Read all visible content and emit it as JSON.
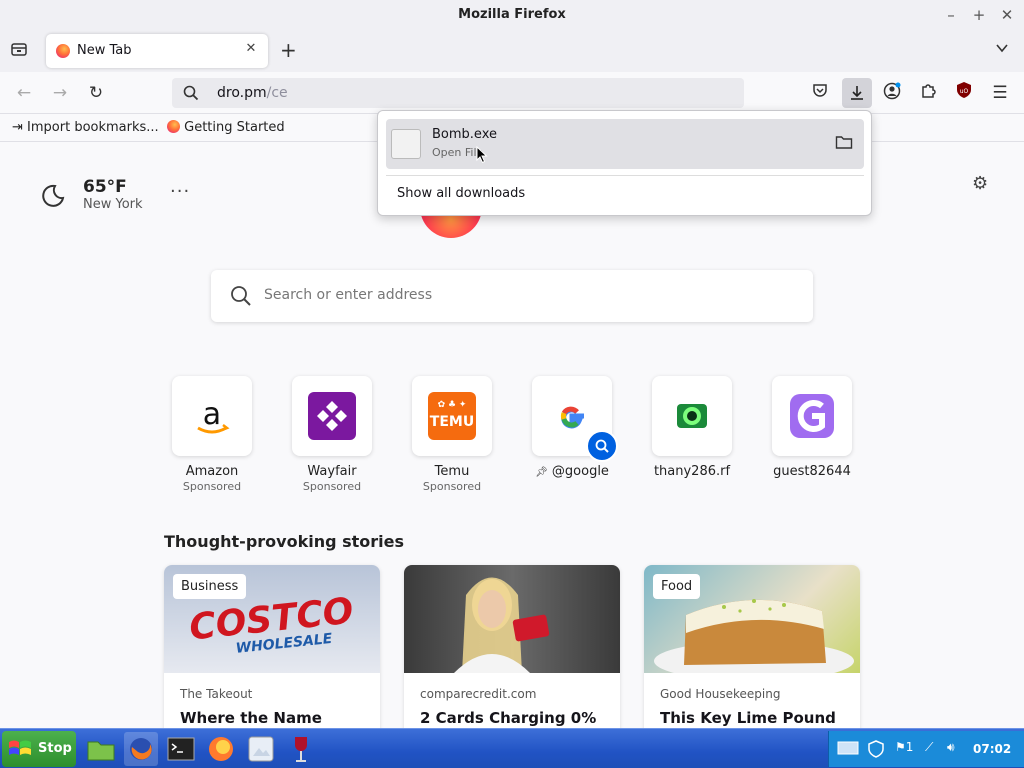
{
  "window": {
    "title": "Mozilla Firefox"
  },
  "tabs": [
    {
      "label": "New Tab"
    }
  ],
  "navbar": {
    "url_host": "dro.pm",
    "url_path": "/ce"
  },
  "bookmarks": [
    {
      "label": "Import bookmarks..."
    },
    {
      "label": "Getting Started"
    }
  ],
  "weather": {
    "temp": "65°F",
    "city": "New York"
  },
  "search": {
    "placeholder": "Search or enter address"
  },
  "shortcuts": [
    {
      "name": "Amazon",
      "sponsored": "Sponsored"
    },
    {
      "name": "Wayfair",
      "sponsored": "Sponsored"
    },
    {
      "name": "Temu",
      "sponsored": "Sponsored"
    },
    {
      "name": "@google",
      "sponsored": ""
    },
    {
      "name": "thany286.rf",
      "sponsored": ""
    },
    {
      "name": "guest82644",
      "sponsored": ""
    }
  ],
  "temu_logo_text": "TEMU",
  "stories": {
    "heading": "Thought-provoking stories",
    "cards": [
      {
        "tag": "Business",
        "source": "The Takeout",
        "title": "Where the Name",
        "image_text": "COSTCO WHOLESALE"
      },
      {
        "tag": "",
        "source": "comparecredit.com",
        "title": "2 Cards Charging 0%"
      },
      {
        "tag": "Food",
        "source": "Good Housekeeping",
        "title": "This Key Lime Pound"
      }
    ]
  },
  "downloads": {
    "items": [
      {
        "filename": "Bomb.exe",
        "status": "Open File"
      }
    ],
    "show_all": "Show all downloads"
  },
  "taskbar": {
    "start_label": "Stop",
    "clock": "07:02",
    "tray_count": "1"
  },
  "colors": {
    "accent": "#0061e0",
    "taskbar": "#2153c4",
    "start": "#3a9e3a"
  }
}
